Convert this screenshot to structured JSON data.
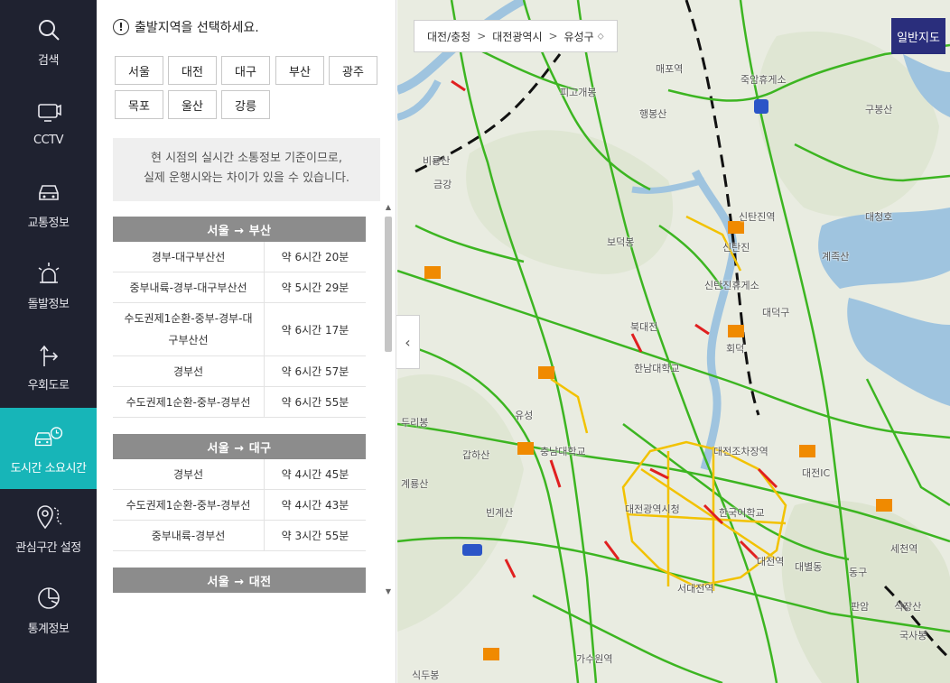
{
  "sidebar": {
    "items": [
      {
        "label": "검색",
        "icon": "search-icon",
        "active": false
      },
      {
        "label": "CCTV",
        "icon": "cctv-icon",
        "active": false
      },
      {
        "label": "교통정보",
        "icon": "car-icon",
        "active": false
      },
      {
        "label": "돌발정보",
        "icon": "alert-light-icon",
        "active": false
      },
      {
        "label": "우회도로",
        "icon": "detour-icon",
        "active": false
      },
      {
        "label": "도시간 소요시간",
        "icon": "car-clock-icon",
        "active": true
      },
      {
        "label": "관심구간 설정",
        "icon": "pin-icon",
        "active": false
      },
      {
        "label": "통계정보",
        "icon": "chart-icon",
        "active": false
      }
    ]
  },
  "panel": {
    "prompt": "출발지역을 선택하세요.",
    "regions": [
      "서울",
      "대전",
      "대구",
      "부산",
      "광주",
      "목포",
      "울산",
      "강릉"
    ],
    "notice_line1": "현 시점의 실시간 소통정보 기준이므로,",
    "notice_line2": "실제 운행시와는 차이가 있을 수 있습니다.",
    "route_groups": [
      {
        "title": "서울 → 부산",
        "rows": [
          {
            "name": "경부-대구부산선",
            "time": "약 6시간 20분"
          },
          {
            "name": "중부내륙-경부-대구부산선",
            "time": "약 5시간 29분"
          },
          {
            "name": "수도권제1순환-중부-경부-대구부산선",
            "time": "약 6시간 17분"
          },
          {
            "name": "경부선",
            "time": "약 6시간 57분"
          },
          {
            "name": "수도권제1순환-중부-경부선",
            "time": "약 6시간 55분"
          }
        ]
      },
      {
        "title": "서울 → 대구",
        "rows": [
          {
            "name": "경부선",
            "time": "약 4시간 45분"
          },
          {
            "name": "수도권제1순환-중부-경부선",
            "time": "약 4시간 43분"
          },
          {
            "name": "중부내륙-경부선",
            "time": "약 3시간 55분"
          }
        ]
      },
      {
        "title": "서울 → 대전",
        "rows": []
      }
    ]
  },
  "map": {
    "breadcrumb": [
      "대전/충청",
      "대전광역시",
      "유성구"
    ],
    "map_type_button": "일반지도",
    "labels": [
      "매포역",
      "죽암휴게소",
      "피고개봉",
      "행봉산",
      "구봉산",
      "금강",
      "대청호",
      "신탄진역",
      "신탄진",
      "보덕봉",
      "신탄진휴게소",
      "대덕구",
      "북대전",
      "회덕",
      "유성",
      "한남대학교",
      "대전조차장역",
      "충남대학교",
      "대전광역시청",
      "한국어학교",
      "대전역",
      "서대전역",
      "가수원역",
      "대전IC",
      "동구",
      "판암",
      "식장산",
      "계족산",
      "두리봉",
      "갑하산",
      "빈계산",
      "비룡산",
      "계룡산",
      "식두봉",
      "세천역",
      "대별동",
      "국사봉"
    ]
  },
  "colors": {
    "sidebar_bg": "#1f2230",
    "active_bg": "#17b5b8",
    "route_header_bg": "#8c8c8c",
    "map_button_bg": "#2a2e7c",
    "road_green": "#3cb521",
    "road_yellow": "#f2c200",
    "road_red": "#e02020",
    "water": "#9fc4df"
  }
}
